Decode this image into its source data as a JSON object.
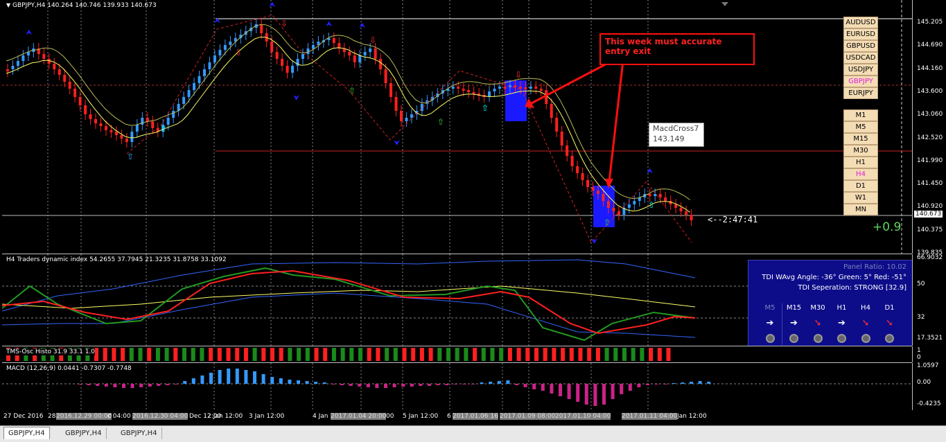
{
  "window": {
    "symbol_title": "GBPJPY,H4",
    "ohlc": "140.264 140.746 139.933 140.673"
  },
  "symbols": [
    "AUDUSD",
    "EURUSD",
    "GBPUSD",
    "USDCAD",
    "USDJPY",
    "GBPJPY",
    "EURJPY"
  ],
  "active_symbol": "GBPJPY",
  "timeframes": [
    "M1",
    "M5",
    "M15",
    "M30",
    "H1",
    "H4",
    "D1",
    "W1",
    "MN"
  ],
  "active_timeframe": "H4",
  "price_axis": {
    "labels": [
      "145.205",
      "144.690",
      "144.160",
      "143.600",
      "143.060",
      "142.520",
      "141.990",
      "141.450",
      "140.920",
      "140.375",
      "139.835"
    ],
    "current": "140.673"
  },
  "annotation": {
    "text": "This week must accurate entry exit"
  },
  "tooltip": {
    "name": "MacdCross7",
    "value": "143.149"
  },
  "countdown": "<--2:47:41",
  "profit": "+0.9",
  "tdi": {
    "title": "H4 Traders dynamic index 54.2655 37.7945 21.3235 31.8758 33.1092",
    "axis": [
      "66.9032",
      "50",
      "32",
      "17.3521"
    ],
    "panel": {
      "ratio": "Panel Ratio: 10.02",
      "angle": "TDI WAvg Angle: -36°  Green: 5°  Red: -51°",
      "separation": "TDI Seperation: STRONG [32.9]",
      "columns": [
        {
          "tf": "M5",
          "arrow": "➔",
          "color": "#ffffff"
        },
        {
          "tf": "M15",
          "arrow": "➔",
          "color": "#ffffff"
        },
        {
          "tf": "M30",
          "arrow": "➘",
          "color": "#ff3030"
        },
        {
          "tf": "H1",
          "arrow": "➔",
          "color": "#ffffff"
        },
        {
          "tf": "H4",
          "arrow": "➘",
          "color": "#ff3030"
        },
        {
          "tf": "D1",
          "arrow": "➘",
          "color": "#ff3030"
        }
      ]
    }
  },
  "tms": {
    "title": "TMS-Osc Histo 31.9 33.1 1.0",
    "axis": [
      "1",
      "0"
    ]
  },
  "macd": {
    "title": "MACD (12,26,9) 0.0441 -0.7307 -0.7748",
    "axis": [
      "1.0597",
      "0.00",
      "-0.4235"
    ]
  },
  "time_axis": [
    {
      "label": "27 Dec 2016",
      "hl": false
    },
    {
      "label": "28",
      "hl": false
    },
    {
      "label": "2016.12.29 00:00",
      "hl": true
    },
    {
      "label": "c 04:00",
      "hl": false
    },
    {
      "label": "2016.12.30 04:00",
      "hl": true
    },
    {
      "label": "Dec 12:00",
      "hl": false
    },
    {
      "label": "2 Jan 12:00",
      "hl": false
    },
    {
      "label": "3 Jan 12:00",
      "hl": false
    },
    {
      "label": "4 Jan",
      "hl": false
    },
    {
      "label": "2017.01.04 20:00",
      "hl": true
    },
    {
      "label": "00",
      "hl": false
    },
    {
      "label": "5 Jan 12:00",
      "hl": false
    },
    {
      "label": "6",
      "hl": false
    },
    {
      "label": "2017.01.06 16",
      "hl": true
    },
    {
      "label": "2017.01.09 08:00",
      "hl": true
    },
    {
      "label": "2017.01.10 04:00",
      "hl": true
    },
    {
      "label": "2017.01.11 04:00",
      "hl": true
    },
    {
      "label": "Jan 12:00",
      "hl": false
    }
  ],
  "tabs": [
    "GBPJPY,H4",
    "GBPJPY,H4",
    "GBPJPY,H4"
  ],
  "colors": {
    "bull": "#3399ff",
    "bear": "#ff2020",
    "ma_yellow": "#ffff66",
    "tdi_green": "#229922",
    "tdi_red": "#ff2020",
    "tdi_blue": "#3366ff",
    "macd_blue": "#3399ff",
    "macd_magenta": "#cc2288"
  }
}
